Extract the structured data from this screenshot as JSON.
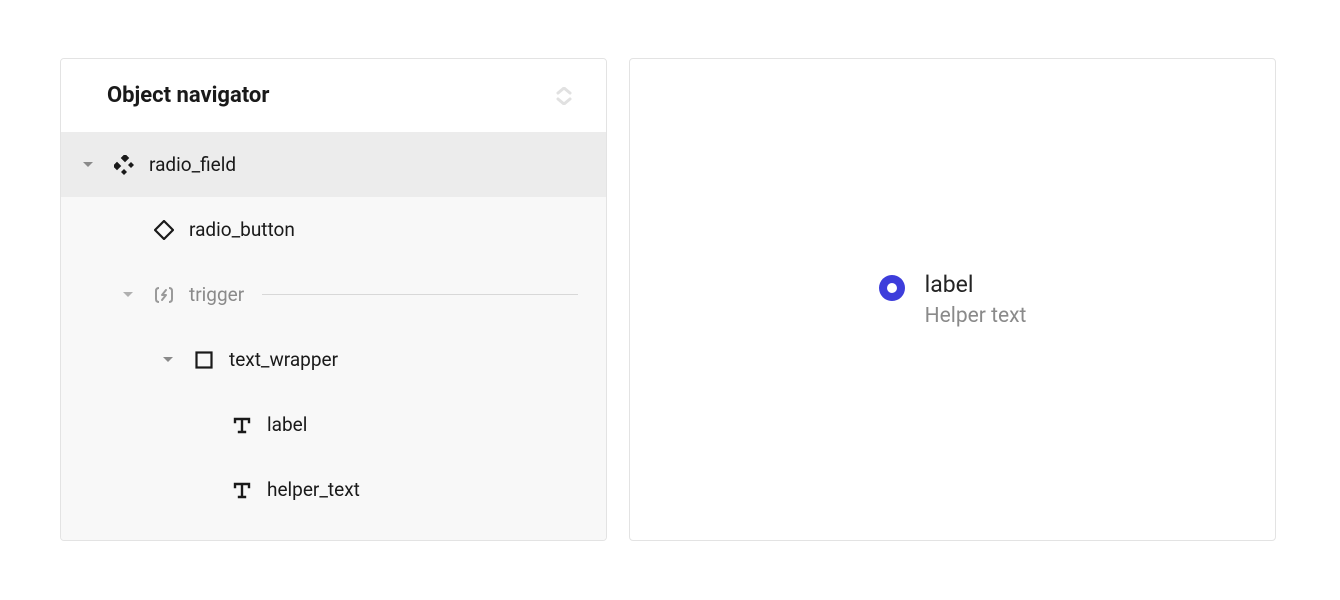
{
  "navigator": {
    "title": "Object navigator",
    "tree": {
      "radio_field": "radio_field",
      "radio_button": "radio_button",
      "trigger": "trigger",
      "text_wrapper": "text_wrapper",
      "label": "label",
      "helper_text": "helper_text"
    }
  },
  "preview": {
    "label": "label",
    "helper_text": "Helper text"
  }
}
